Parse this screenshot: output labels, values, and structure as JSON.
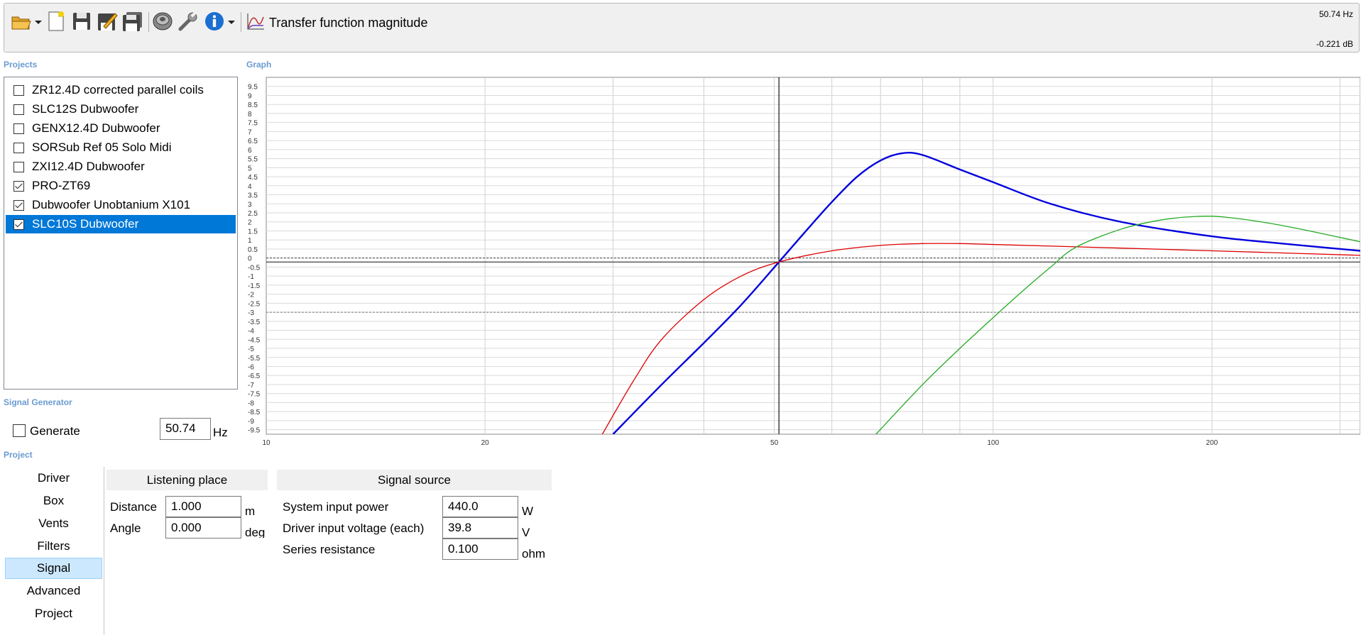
{
  "toolbar": {
    "graph_title": "Transfer function magnitude",
    "icons": [
      "open-folder-icon",
      "new-document-icon",
      "save-icon",
      "save-as-icon",
      "save-all-icon",
      "speaker-icon",
      "wrench-icon",
      "info-icon",
      "graph-icon"
    ],
    "readout_freq": "50.74 Hz",
    "readout_db": "-0.221 dB"
  },
  "projects": {
    "label": "Projects",
    "items": [
      {
        "name": "ZR12.4D corrected parallel coils",
        "checked": false
      },
      {
        "name": "SLC12S Dubwoofer",
        "checked": false
      },
      {
        "name": "GENX12.4D Dubwoofer",
        "checked": false
      },
      {
        "name": "SORSub Ref 05 Solo Midi",
        "checked": false
      },
      {
        "name": "ZXI12.4D Dubwoofer",
        "checked": false
      },
      {
        "name": "PRO-ZT69",
        "checked": true
      },
      {
        "name": "Dubwoofer Unobtanium X101",
        "checked": true
      },
      {
        "name": "SLC10S Dubwoofer",
        "checked": true
      }
    ],
    "selected_index": 7
  },
  "signal_generator": {
    "label": "Signal Generator",
    "generate_label": "Generate",
    "generate_checked": false,
    "frequency": "50.74",
    "unit": "Hz"
  },
  "graph": {
    "label": "Graph"
  },
  "chart_data": {
    "type": "line",
    "x_scale": "log",
    "xlim": [
      10,
      320
    ],
    "ylim": [
      -9.75,
      10
    ],
    "x_tick_labels": [
      "10",
      "20",
      "50",
      "100",
      "200"
    ],
    "y_tick_labels": [
      "9.5",
      "9",
      "8.5",
      "8",
      "7.5",
      "7",
      "6.5",
      "6",
      "5.5",
      "5",
      "4.5",
      "4",
      "3.5",
      "3",
      "2.5",
      "2",
      "1.5",
      "1",
      "0.5",
      "0",
      "-0.5",
      "-1",
      "-1.5",
      "-2",
      "-2.5",
      "-3",
      "-3.5",
      "-4",
      "-4.5",
      "-5",
      "-5.5",
      "-6",
      "-6.5",
      "-7",
      "-7.5",
      "-8",
      "-8.5",
      "-9",
      "-9.5"
    ],
    "cursor_x": 50.74,
    "reference_lines_db": [
      0,
      -3
    ],
    "grid": true,
    "series": [
      {
        "color": "#0000dd",
        "x": [
          30,
          35,
          40,
          45,
          50.74,
          55,
          60,
          65,
          70,
          75,
          80,
          90,
          100,
          120,
          150,
          200,
          250,
          320
        ],
        "y": [
          -9.75,
          -7.0,
          -4.7,
          -2.6,
          -0.22,
          1.4,
          3.1,
          4.5,
          5.4,
          5.8,
          5.7,
          4.9,
          4.2,
          3.0,
          2.0,
          1.2,
          0.8,
          0.4
        ]
      },
      {
        "color": "#dd0000",
        "x": [
          29,
          32,
          35,
          40,
          45,
          50.74,
          60,
          70,
          80,
          90,
          100,
          150,
          200,
          320
        ],
        "y": [
          -9.75,
          -6.8,
          -4.5,
          -2.3,
          -1.0,
          -0.22,
          0.4,
          0.7,
          0.8,
          0.8,
          0.75,
          0.55,
          0.4,
          0.15
        ]
      },
      {
        "color": "#22aa22",
        "x": [
          69,
          80,
          90,
          100,
          110,
          120,
          130,
          150,
          170,
          190,
          210,
          250,
          320
        ],
        "y": [
          -9.75,
          -7.0,
          -5.0,
          -3.3,
          -1.8,
          -0.5,
          0.6,
          1.6,
          2.1,
          2.3,
          2.25,
          1.8,
          0.9
        ]
      }
    ]
  },
  "project_panel": {
    "label": "Project",
    "tabs": [
      "Driver",
      "Box",
      "Vents",
      "Filters",
      "Signal",
      "Advanced",
      "Project"
    ],
    "active_tab": 4
  },
  "listening_place": {
    "header": "Listening place",
    "distance_label": "Distance",
    "distance_value": "1.000",
    "distance_unit": "m",
    "angle_label": "Angle",
    "angle_value": "0.000",
    "angle_unit": "deg"
  },
  "signal_source": {
    "header": "Signal source",
    "power_label": "System input power",
    "power_value": "440.0",
    "power_unit": "W",
    "voltage_label": "Driver input voltage (each)",
    "voltage_value": "39.8",
    "voltage_unit": "V",
    "resistance_label": "Series resistance",
    "resistance_value": "0.100",
    "resistance_unit": "ohm"
  }
}
